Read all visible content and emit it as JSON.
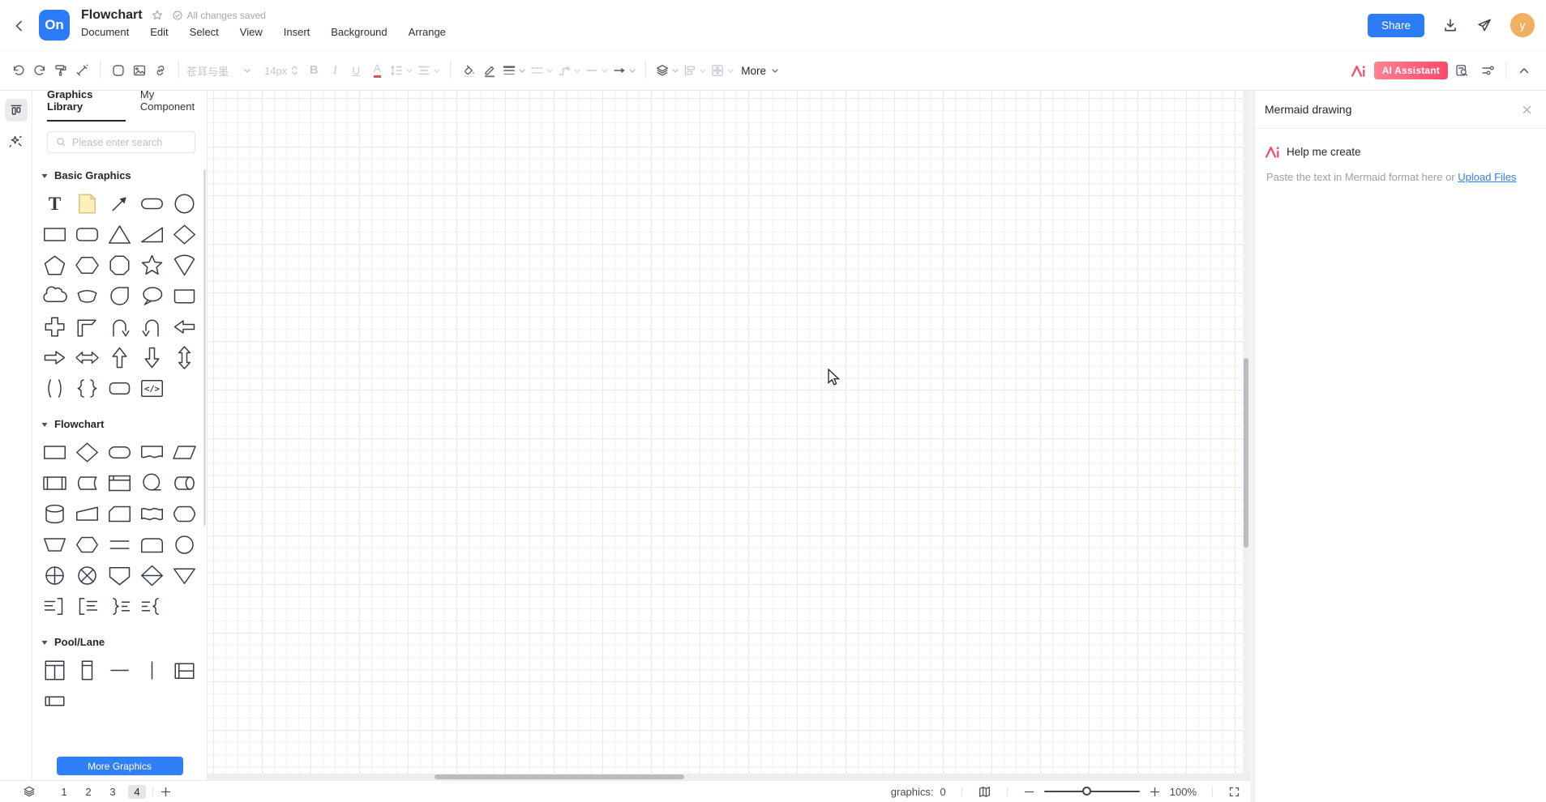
{
  "header": {
    "logo_text": "On",
    "title": "Flowchart",
    "save_status": "All changes saved",
    "menus": [
      "Document",
      "Edit",
      "Select",
      "View",
      "Insert",
      "Background",
      "Arrange"
    ],
    "share_label": "Share",
    "avatar_letter": "y",
    "icons": [
      "back-chevron-icon",
      "star-icon",
      "check-circle-icon",
      "download-icon",
      "send-icon"
    ]
  },
  "toolbar": {
    "font_family": "苍耳与墨",
    "font_size": "14px",
    "more_label": "More",
    "ai_label": "AI Assistant",
    "history_icons": [
      "undo",
      "redo",
      "format-painter",
      "style-pen"
    ],
    "insert_icons": [
      "shape",
      "image",
      "link"
    ],
    "text_icons": [
      "bold",
      "italic",
      "underline",
      "font-color",
      "line-height",
      "text-align"
    ],
    "style_icons": [
      "fill-color",
      "stroke-color",
      "line-width",
      "line-style",
      "connector",
      "arrow-start",
      "arrow-end"
    ],
    "arrange_icons": [
      "layer",
      "align-objects",
      "match-size"
    ],
    "right_icons": [
      "find-replace",
      "adjust"
    ]
  },
  "sidebar": {
    "tabs": [
      {
        "label": "Graphics Library",
        "active": true
      },
      {
        "label": "My Component",
        "active": false
      }
    ],
    "search_placeholder": "Please enter search",
    "sections": [
      {
        "title": "Basic Graphics",
        "shapes": [
          "text",
          "sticky-note",
          "arrow-diagonal",
          "flat-rounded-rect",
          "circle",
          "rectangle",
          "rounded-rectangle",
          "triangle",
          "right-triangle",
          "diamond",
          "pentagon",
          "hexagon",
          "octagon",
          "star",
          "sector",
          "cloud",
          "arc",
          "teardrop",
          "speech-bubble",
          "folded-rect",
          "cross",
          "angle",
          "u-turn-right",
          "u-turn-left",
          "arrow-left",
          "arrow-right",
          "arrow-double-h",
          "arrow-up",
          "arrow-down",
          "arrow-double-v",
          "parentheses",
          "braces",
          "rounded-box",
          "code-block"
        ]
      },
      {
        "title": "Flowchart",
        "shapes": [
          "process",
          "decision",
          "terminator",
          "document",
          "data",
          "predefined-process",
          "stored-data",
          "internal-storage",
          "sequential-data",
          "direct-data",
          "database",
          "manual-input",
          "card",
          "paper-tape",
          "hexagon-rounded",
          "manual-operation",
          "preparation",
          "parallel-mode",
          "display",
          "connector-node",
          "or-junction",
          "summing-junction",
          "off-page-connector",
          "sort",
          "merge",
          "comment-right",
          "comment-left",
          "brace-right",
          "brace-left"
        ]
      },
      {
        "title": "Pool/Lane",
        "shapes": [
          "pool-vertical-2",
          "pool-vertical-1",
          "lane-horizontal",
          "lane-vertical",
          "pool-horizontal-2",
          "pool-horizontal-1"
        ]
      }
    ],
    "more_button": "More Graphics"
  },
  "right_panel": {
    "title": "Mermaid drawing",
    "help_label": "Help me create",
    "hint_text": "Paste the text in Mermaid format here or ",
    "upload_link": "Upload Files"
  },
  "bottom_bar": {
    "pages": [
      "1",
      "2",
      "3",
      "4"
    ],
    "active_page": "4",
    "graphics_label": "graphics:",
    "graphics_count": "0",
    "zoom_level": "100%",
    "icons": [
      "layers-stack-icon",
      "add-page-icon",
      "minimap-icon",
      "zoom-out-icon",
      "zoom-in-icon",
      "fullscreen-icon"
    ]
  },
  "colors": {
    "accent_blue": "#2b7cf6",
    "ai_pink": "#fb4a6b",
    "avatar_orange": "#f1b05f",
    "sticky_yellow": "#fcf0bb"
  }
}
